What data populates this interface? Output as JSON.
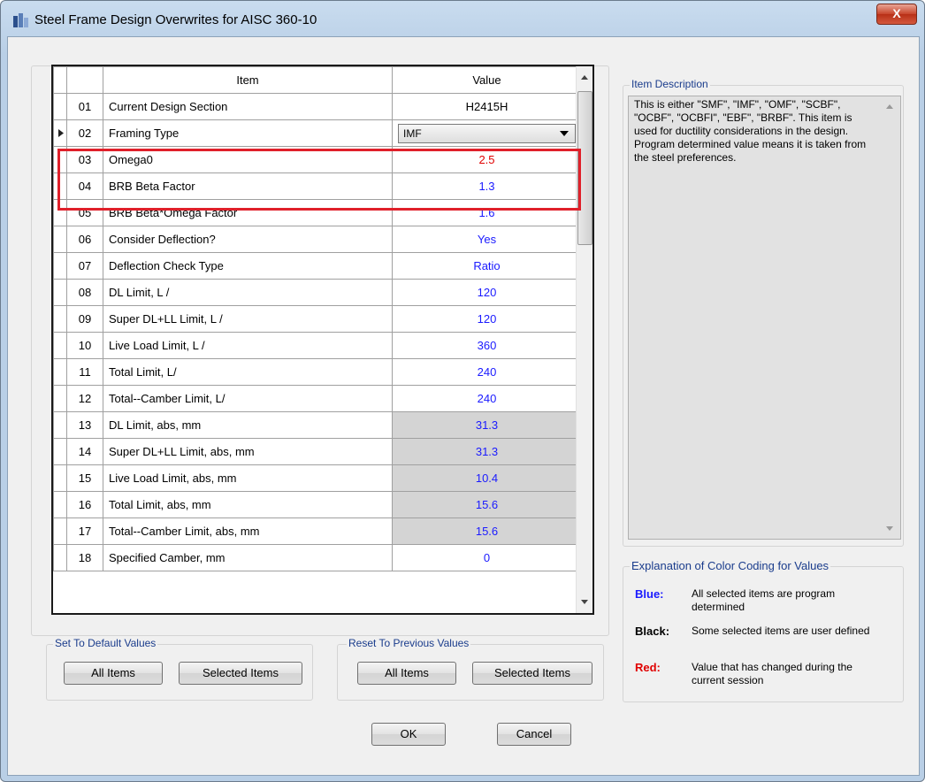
{
  "window": {
    "title": "Steel Frame Design Overwrites for AISC 360-10",
    "close_label": "X"
  },
  "grid": {
    "headers": {
      "item": "Item",
      "value": "Value"
    },
    "rows": [
      {
        "num": "01",
        "item": "Current Design Section",
        "value": "H2415H",
        "color": "black",
        "shaded": false
      },
      {
        "num": "02",
        "item": "Framing Type",
        "value": "IMF",
        "color": "black",
        "shaded": false,
        "dropdown": true,
        "current": true
      },
      {
        "num": "03",
        "item": "Omega0",
        "value": "2.5",
        "color": "red",
        "shaded": false
      },
      {
        "num": "04",
        "item": "BRB Beta Factor",
        "value": "1.3",
        "color": "blue",
        "shaded": false
      },
      {
        "num": "05",
        "item": "BRB Beta*Omega Factor",
        "value": "1.6",
        "color": "blue",
        "shaded": false
      },
      {
        "num": "06",
        "item": "Consider Deflection?",
        "value": "Yes",
        "color": "blue",
        "shaded": false
      },
      {
        "num": "07",
        "item": "Deflection Check Type",
        "value": "Ratio",
        "color": "blue",
        "shaded": false
      },
      {
        "num": "08",
        "item": "DL Limit, L /",
        "value": "120",
        "color": "blue",
        "shaded": false
      },
      {
        "num": "09",
        "item": "Super DL+LL Limit, L /",
        "value": "120",
        "color": "blue",
        "shaded": false
      },
      {
        "num": "10",
        "item": "Live Load Limit, L /",
        "value": "360",
        "color": "blue",
        "shaded": false
      },
      {
        "num": "11",
        "item": "Total Limit, L/",
        "value": "240",
        "color": "blue",
        "shaded": false
      },
      {
        "num": "12",
        "item": "Total--Camber Limit, L/",
        "value": "240",
        "color": "blue",
        "shaded": false
      },
      {
        "num": "13",
        "item": "DL Limit, abs, mm",
        "value": "31.3",
        "color": "blue",
        "shaded": true
      },
      {
        "num": "14",
        "item": "Super DL+LL Limit, abs, mm",
        "value": "31.3",
        "color": "blue",
        "shaded": true
      },
      {
        "num": "15",
        "item": "Live Load Limit, abs, mm",
        "value": "10.4",
        "color": "blue",
        "shaded": true
      },
      {
        "num": "16",
        "item": "Total Limit, abs, mm",
        "value": "15.6",
        "color": "blue",
        "shaded": true
      },
      {
        "num": "17",
        "item": "Total--Camber Limit, abs, mm",
        "value": "15.6",
        "color": "blue",
        "shaded": true
      },
      {
        "num": "18",
        "item": "Specified Camber, mm",
        "value": "0",
        "color": "blue",
        "shaded": false
      }
    ]
  },
  "item_description": {
    "label": "Item Description",
    "text": "This is either \"SMF\", \"IMF\", \"OMF\", \"SCBF\", \"OCBF\", \"OCBFI\", \"EBF\", \"BRBF\".  This item is used for ductility considerations in the design. Program determined value means it is taken from the steel preferences."
  },
  "color_coding": {
    "label": "Explanation of Color Coding for Values",
    "entries": [
      {
        "key": "Blue:",
        "text": "All selected items are program determined",
        "color": "#1a1aff"
      },
      {
        "key": "Black:",
        "text": "Some selected items are user defined",
        "color": "#000000"
      },
      {
        "key": "Red:",
        "text": "Value that has changed during the current session",
        "color": "#e00000"
      }
    ]
  },
  "set_default": {
    "label": "Set To Default Values",
    "all_items": "All Items",
    "selected_items": "Selected Items"
  },
  "reset_previous": {
    "label": "Reset To Previous Values",
    "all_items": "All Items",
    "selected_items": "Selected Items"
  },
  "footer": {
    "ok": "OK",
    "cancel": "Cancel"
  },
  "colors": {
    "blue": "#1a1aff",
    "red": "#e00000",
    "black": "#000000",
    "highlight": "#e0202a"
  }
}
